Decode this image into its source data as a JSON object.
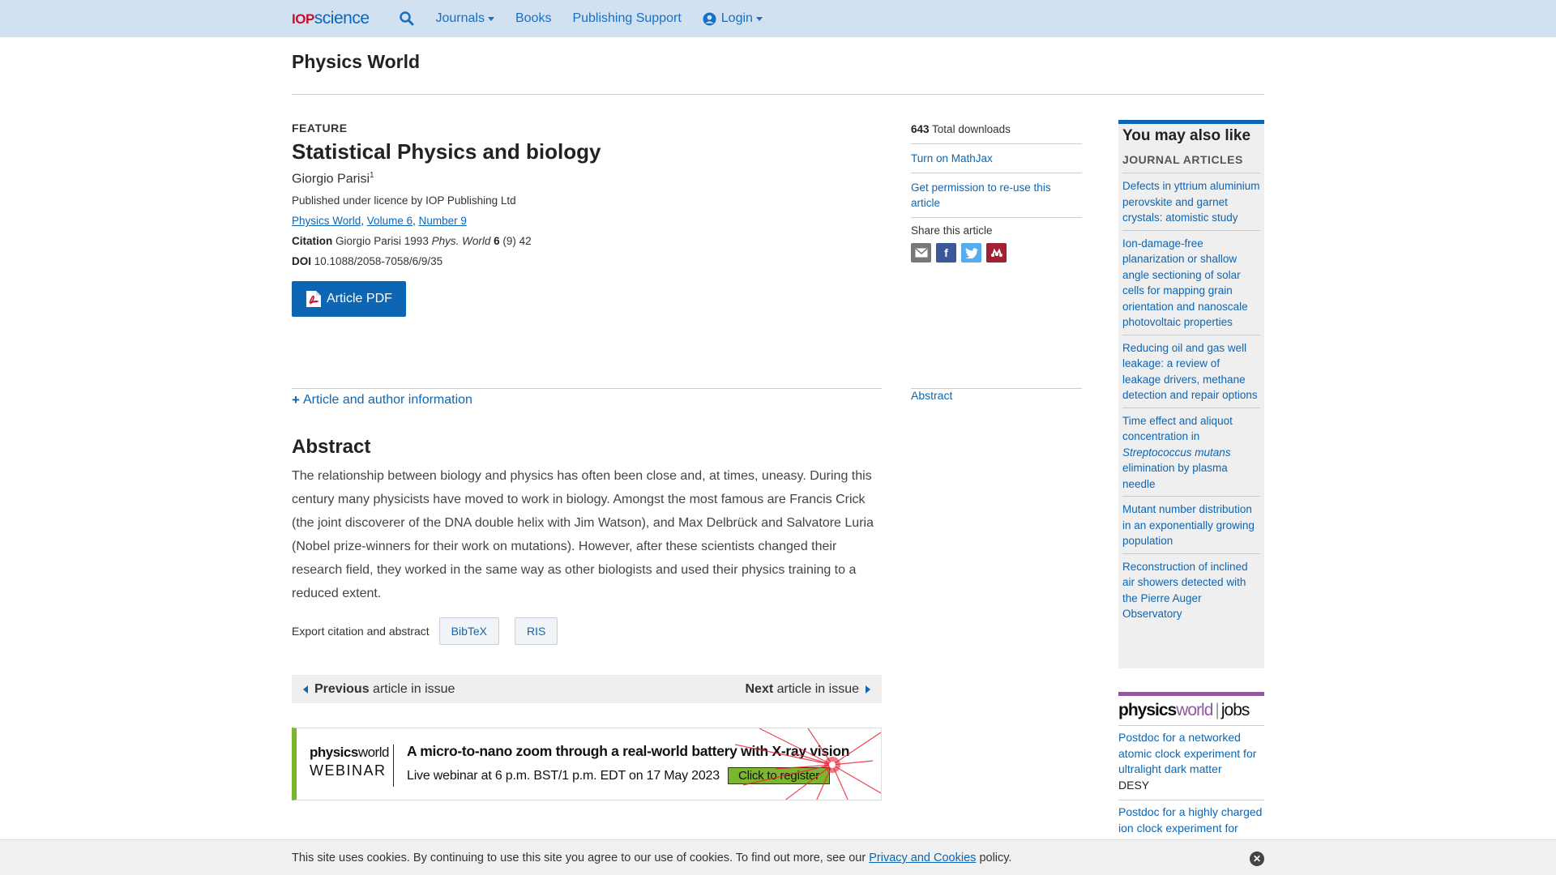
{
  "header": {
    "logo_iop": "IOP",
    "logo_science": "science",
    "nav": {
      "journals": "Journals",
      "books": "Books",
      "publishing_support": "Publishing Support",
      "login": "Login"
    }
  },
  "journal_title": "Physics World",
  "article": {
    "type_label": "FEATURE",
    "title": "Statistical Physics and biology",
    "author": "Giorgio Parisi",
    "author_affil": "1",
    "licence": "Published under licence by IOP Publishing Ltd",
    "breadcrumbs": {
      "journal": "Physics World",
      "volume": "Volume 6",
      "number": "Number 9"
    },
    "citation_label": "Citation",
    "citation_author_year": "Giorgio Parisi 1993",
    "citation_journal": "Phys. World",
    "citation_volume": "6",
    "citation_rest": "(9) 42",
    "doi_label": "DOI",
    "doi": "10.1088/2058-7058/6/9/35",
    "pdf_button": "Article PDF"
  },
  "sidebar": {
    "downloads_count": "643",
    "downloads_label": "Total downloads",
    "mathjax": "Turn on MathJax",
    "permission": "Get permission to re-use this article",
    "share_label": "Share this article",
    "abstract_link": "Abstract"
  },
  "article_info_toggle": "Article and author information",
  "abstract": {
    "heading": "Abstract",
    "text": "The relationship between biology and physics has often been close and, at times, uneasy. During this century many physicists have moved to work in biology. Amongst the most famous are Francis Crick (the joint discoverer of the DNA double helix with Jim Watson), and Max Delbrück and Salvatore Luria (Nobel prize-winners for their work on mutations). However, after these scientists changed their research field, they worked in the same way as other biologists and used their physics training to a reduced extent."
  },
  "export": {
    "label": "Export citation and abstract",
    "bibtex": "BibTeX",
    "ris": "RIS"
  },
  "issue_nav": {
    "prev_bold": "Previous",
    "prev_rest": "article in issue",
    "next_bold": "Next",
    "next_rest": "article in issue"
  },
  "banner": {
    "brand_physics": "physics",
    "brand_world": "world",
    "brand_webinar": "WEBINAR",
    "headline": "A micro-to-nano zoom through a real-world battery with X-ray vision",
    "subline": "Live webinar at 6 p.m. BST/1 p.m. EDT on 17 May 2023",
    "cta": "Click to register"
  },
  "you_may_also_like": {
    "heading": "You may also like",
    "subheading": "JOURNAL ARTICLES",
    "items": [
      "Defects in yttrium aluminium perovskite and garnet crystals: atomistic study",
      "Ion-damage-free planarization or shallow angle sectioning of solar cells for mapping grain orientation and nanoscale photovoltaic properties",
      "Reducing oil and gas well leakage: a review of leakage drivers, methane detection and repair options",
      "Time effect and aliquot concentration in Streptococcus mutans elimination by plasma needle",
      "Mutant number distribution in an exponentially growing population",
      "Reconstruction of inclined air showers detected with the Pierre Auger Observatory"
    ]
  },
  "jobs": {
    "logo_physics": "physics",
    "logo_world": "world",
    "logo_jobs": "jobs",
    "listings": [
      {
        "title": "Postdoc for a networked atomic clock experiment for ultralight dark matter",
        "org": "DESY"
      },
      {
        "title": "Postdoc for a highly charged ion clock experiment for ultralight dark matter",
        "org": ""
      }
    ]
  },
  "cookie": {
    "text_before": "This site uses cookies. By continuing to use this site you agree to our use of cookies. To find out more, see our",
    "link": "Privacy and Cookies",
    "text_after": "policy."
  },
  "colors": {
    "brand_blue": "#0d66b3",
    "topbar_bg": "#d2e1f1",
    "iop_red": "#c8102e",
    "webinar_green": "#7cb62e",
    "jobs_purple": "#8e5a9d"
  }
}
